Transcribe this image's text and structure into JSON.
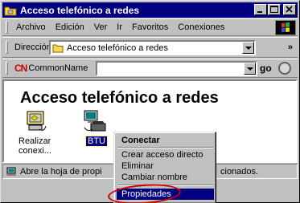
{
  "window": {
    "title": "Acceso telefónico a redes"
  },
  "menubar": {
    "items": [
      "Archivo",
      "Edición",
      "Ver",
      "Ir",
      "Favoritos",
      "Conexiones"
    ]
  },
  "address": {
    "label": "Dirección",
    "value": "Acceso telefónico a redes"
  },
  "commonname": {
    "logo": "CN",
    "label": "CommonName",
    "go": "go",
    "value": ""
  },
  "content": {
    "heading": "Acceso telefónico a redes",
    "icons": [
      {
        "label": "Realizar conexi..."
      },
      {
        "label": "BTU"
      }
    ]
  },
  "status": {
    "text": "Abre la hoja de propi",
    "text_tail": "cionados."
  },
  "context_menu": {
    "items": [
      "Conectar",
      "Crear acceso directo",
      "Eliminar",
      "Cambiar nombre",
      "Propiedades"
    ],
    "default": "Conectar",
    "selected": "Propiedades"
  },
  "colors": {
    "titlebar": "#000080",
    "selection": "#000080",
    "highlight_ring": "#d00000",
    "face": "#c0c0c0"
  }
}
